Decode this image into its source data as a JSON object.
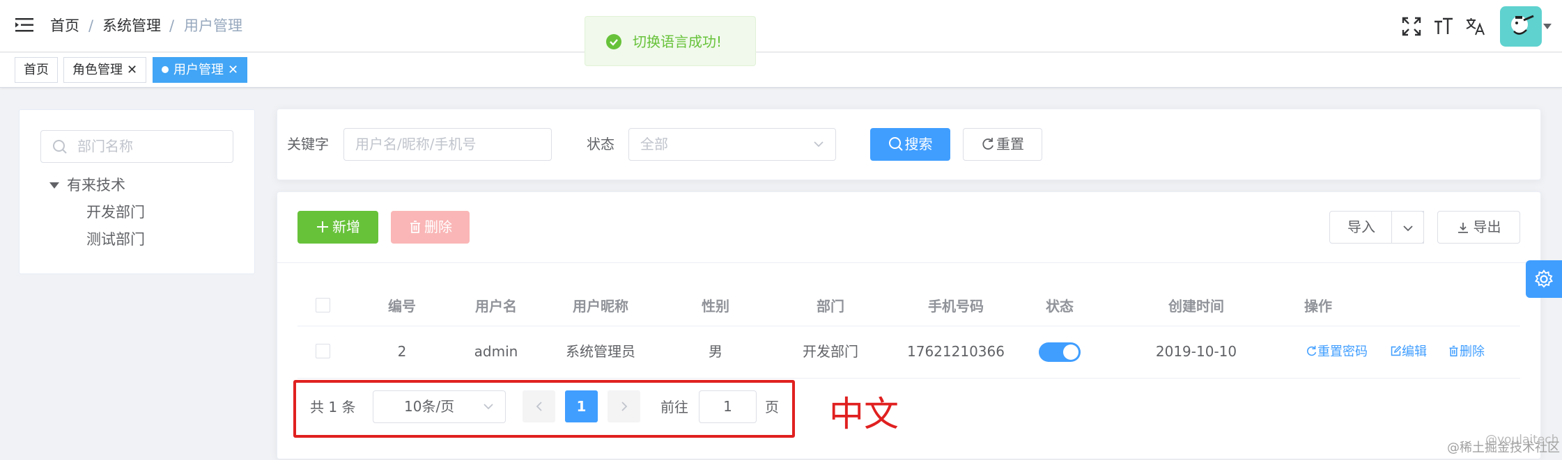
{
  "breadcrumb": {
    "home": "首页",
    "sep": "/",
    "system": "系统管理",
    "current": "用户管理"
  },
  "toolbar_icons": [
    "fullscreen-icon",
    "font-size-icon",
    "translate-icon"
  ],
  "tags": [
    {
      "label": "首页",
      "active": false,
      "closable": false
    },
    {
      "label": "角色管理",
      "active": false,
      "closable": true
    },
    {
      "label": "用户管理",
      "active": true,
      "closable": true
    }
  ],
  "tag_close": "✕",
  "message": {
    "text": "切换语言成功!",
    "type": "success"
  },
  "dept_tree": {
    "search_placeholder": "部门名称",
    "root": "有来技术",
    "children": [
      "开发部门",
      "测试部门"
    ]
  },
  "search_form": {
    "keyword_label": "关键字",
    "keyword_placeholder": "用户名/昵称/手机号",
    "status_label": "状态",
    "status_placeholder": "全部",
    "search_button": "搜索",
    "reset_button": "重置"
  },
  "actions": {
    "add": "新增",
    "delete": "删除",
    "import": "导入",
    "export": "导出"
  },
  "table": {
    "headers": [
      "编号",
      "用户名",
      "用户昵称",
      "性别",
      "部门",
      "手机号码",
      "状态",
      "创建时间",
      "操作"
    ],
    "rows": [
      {
        "id": "2",
        "username": "admin",
        "nickname": "系统管理员",
        "gender": "男",
        "dept": "开发部门",
        "mobile": "17621210366",
        "status_enabled": true,
        "created": "2019-10-10",
        "ops": [
          "重置密码",
          "编辑",
          "删除"
        ]
      }
    ]
  },
  "pagination": {
    "total_text": "共 1 条",
    "page_size": "10条/页",
    "current_page": "1",
    "goto_label": "前往",
    "goto_value": "1",
    "page_suffix": "页"
  },
  "annotation": "中文",
  "watermark": {
    "line1": "@youlaitech",
    "line2": "@稀土掘金技术社区"
  },
  "colors": {
    "primary": "#409eff",
    "success": "#67c23a",
    "danger": "#f56c6c",
    "annotation": "#e02020"
  }
}
